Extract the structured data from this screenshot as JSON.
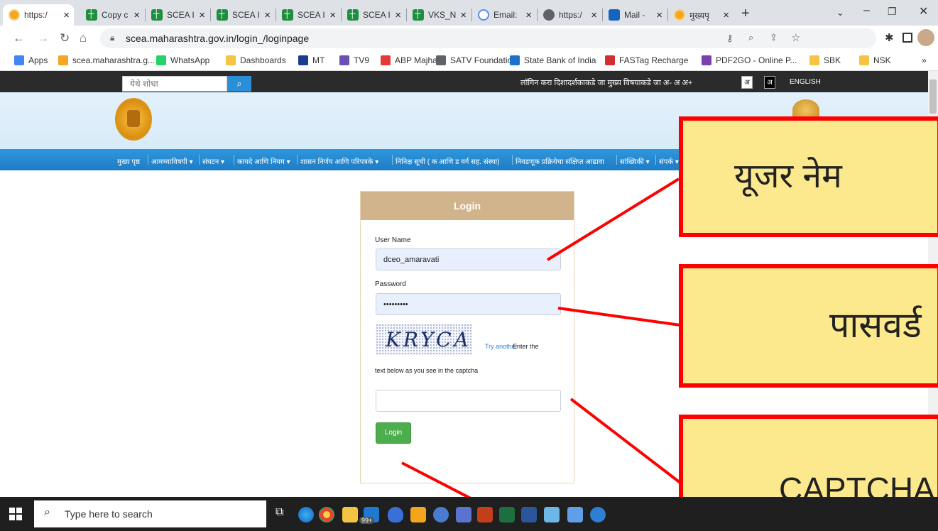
{
  "browser": {
    "tabs": [
      {
        "label": "https:/",
        "icon": "gov-favicon",
        "active": true
      },
      {
        "label": "Copy c",
        "icon": "sheets-icon"
      },
      {
        "label": "SCEA I",
        "icon": "sheets-icon"
      },
      {
        "label": "SCEA I",
        "icon": "sheets-icon"
      },
      {
        "label": "SCEA I",
        "icon": "sheets-icon"
      },
      {
        "label": "SCEA I",
        "icon": "sheets-icon"
      },
      {
        "label": "VKS_N",
        "icon": "sheets-icon"
      },
      {
        "label": "Email:",
        "icon": "at-icon"
      },
      {
        "label": "https:/",
        "icon": "globe-icon"
      },
      {
        "label": "Mail -",
        "icon": "outlook-icon"
      },
      {
        "label": "मुख्यपृ",
        "icon": "gov-favicon"
      }
    ],
    "close_glyph": "×",
    "new_tab_glyph": "+",
    "url": "scea.maharashtra.gov.in/login_/loginpage",
    "bookmarks": [
      {
        "label": "Apps",
        "color": "#4285f4"
      },
      {
        "label": "scea.maharashtra.g...",
        "color": "#f5a623"
      },
      {
        "label": "WhatsApp",
        "color": "#25d366"
      },
      {
        "label": "Dashboards",
        "color": "#f6c343"
      },
      {
        "label": "MT",
        "color": "#1a3c8f"
      },
      {
        "label": "TV9",
        "color": "#6a4fb5"
      },
      {
        "label": "ABP Majha",
        "color": "#e53935"
      },
      {
        "label": "SATV Foundation",
        "color": "#5f6368"
      },
      {
        "label": "State Bank of India",
        "color": "#1a73c9"
      },
      {
        "label": "FASTag Recharge",
        "color": "#d32f2f"
      },
      {
        "label": "PDF2GO - Online P...",
        "color": "#7b3fb0"
      },
      {
        "label": "SBK",
        "color": "#f6c343"
      },
      {
        "label": "NSK",
        "color": "#f6c343"
      }
    ],
    "bookmarks_more": "»"
  },
  "site": {
    "search_placeholder": "येथे शोधा",
    "search_icon": "search-icon",
    "top_links": "लॉगिन करा  दिशादर्शकाकडे जा  मुख्य विषयाकडे जा  अ-  अ  अ+",
    "lang_a": "अ",
    "lang_b": "अ",
    "lang_english": "ENGLISH",
    "nav": [
      "मुख्य पृष्ठ",
      "आमच्याविषयी ▾",
      "संघटन ▾",
      "कायदे आणि नियम ▾",
      "शासन निर्णय आणि परिपत्रके ▾",
      "निनिक्ष सूची ( क आणि ड वर्ग सह. संस्था)",
      "निवडणूक प्रक्रियेचा संक्षिप्त आढावा",
      "सांख्यिकी ▾",
      "संपर्क ▾"
    ]
  },
  "login": {
    "heading": "Login",
    "username_label": "User Name",
    "username_value": "dceo_amaravati",
    "password_label": "Password",
    "password_value": "•••••••••",
    "captcha_text": "KRYCA",
    "try_another": "Try another",
    "captcha_hint_a": "Enter the",
    "captcha_hint_b": "text below as you see in the captcha",
    "captcha_value": "",
    "button": "Login"
  },
  "annotations": {
    "username": "यूजर नेम",
    "password": "पासवर्ड",
    "captcha": "CAPTCHA",
    "border_color": "#ff0000",
    "fill_color": "#fde98d"
  },
  "taskbar": {
    "search_placeholder": "Type here to search",
    "badge": "99+"
  }
}
